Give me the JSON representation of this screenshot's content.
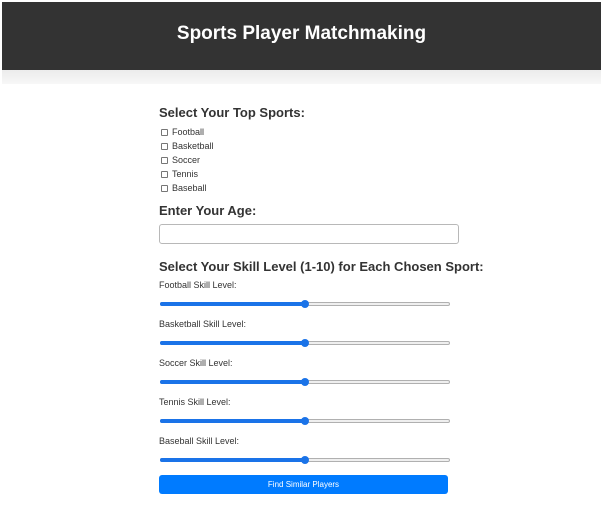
{
  "header": {
    "title": "Sports Player Matchmaking"
  },
  "sports_section": {
    "title": "Select Your Top Sports:",
    "options": [
      {
        "label": "Football",
        "checked": false
      },
      {
        "label": "Basketball",
        "checked": false
      },
      {
        "label": "Soccer",
        "checked": false
      },
      {
        "label": "Tennis",
        "checked": false
      },
      {
        "label": "Baseball",
        "checked": false
      }
    ]
  },
  "age_section": {
    "title": "Enter Your Age:",
    "value": "",
    "placeholder": ""
  },
  "skill_section": {
    "title": "Select Your Skill Level (1-10) for Each Chosen Sport:",
    "scale_min": 1,
    "scale_max": 10,
    "sliders": [
      {
        "label": "Football Skill Level:",
        "value": 5.5
      },
      {
        "label": "Basketball Skill Level:",
        "value": 5.5
      },
      {
        "label": "Soccer Skill Level:",
        "value": 5.5
      },
      {
        "label": "Tennis Skill Level:",
        "value": 5.5
      },
      {
        "label": "Baseball Skill Level:",
        "value": 5.5
      }
    ]
  },
  "submit": {
    "label": "Find Similar Players"
  },
  "colors": {
    "header_bg": "#333333",
    "header_text": "#ffffff",
    "accent": "#1a73e8",
    "button_bg": "#007bff"
  }
}
